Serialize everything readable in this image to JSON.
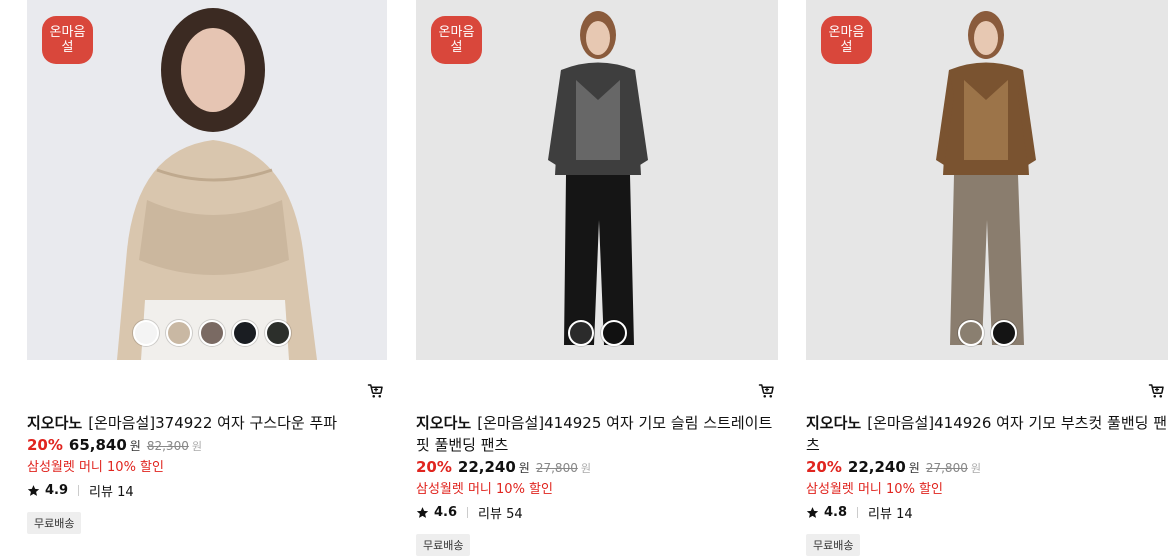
{
  "products": [
    {
      "badge": [
        "온마음",
        "설"
      ],
      "brand": "지오다노",
      "name": "[온마음설]374922 여자 구스다운 푸파",
      "discount": "20%",
      "price": "65,840",
      "currency": "원",
      "original_price": "82,300",
      "promo": "삼성월렛 머니 10% 할인",
      "rating": "4.9",
      "reviews": "리뷰 14",
      "tag": "무료배송",
      "swatches": [
        "#f4f4f4",
        "#c9b8a3",
        "#7a6a63",
        "#1a1d22",
        "#2c2f2b"
      ]
    },
    {
      "badge": [
        "온마음",
        "설"
      ],
      "brand": "지오다노",
      "name": "[온마음설]414925 여자 기모 슬림 스트레이트 핏 풀밴딩 팬츠",
      "discount": "20%",
      "price": "22,240",
      "currency": "원",
      "original_price": "27,800",
      "promo": "삼성월렛 머니 10% 할인",
      "rating": "4.6",
      "reviews": "리뷰 54",
      "tag": "무료배송",
      "swatches": [
        "#2b2b2b",
        "#111111"
      ]
    },
    {
      "badge": [
        "온마음",
        "설"
      ],
      "brand": "지오다노",
      "name": "[온마음설]414926 여자 기모 부츠컷 풀밴딩 팬츠",
      "discount": "20%",
      "price": "22,240",
      "currency": "원",
      "original_price": "27,800",
      "promo": "삼성월렛 머니 10% 할인",
      "rating": "4.8",
      "reviews": "리뷰 14",
      "tag": "무료배송",
      "swatches": [
        "#8a7f70",
        "#141414"
      ]
    }
  ],
  "colors": {
    "accent_red": "#e0251f",
    "badge_red": "#d9473b"
  }
}
